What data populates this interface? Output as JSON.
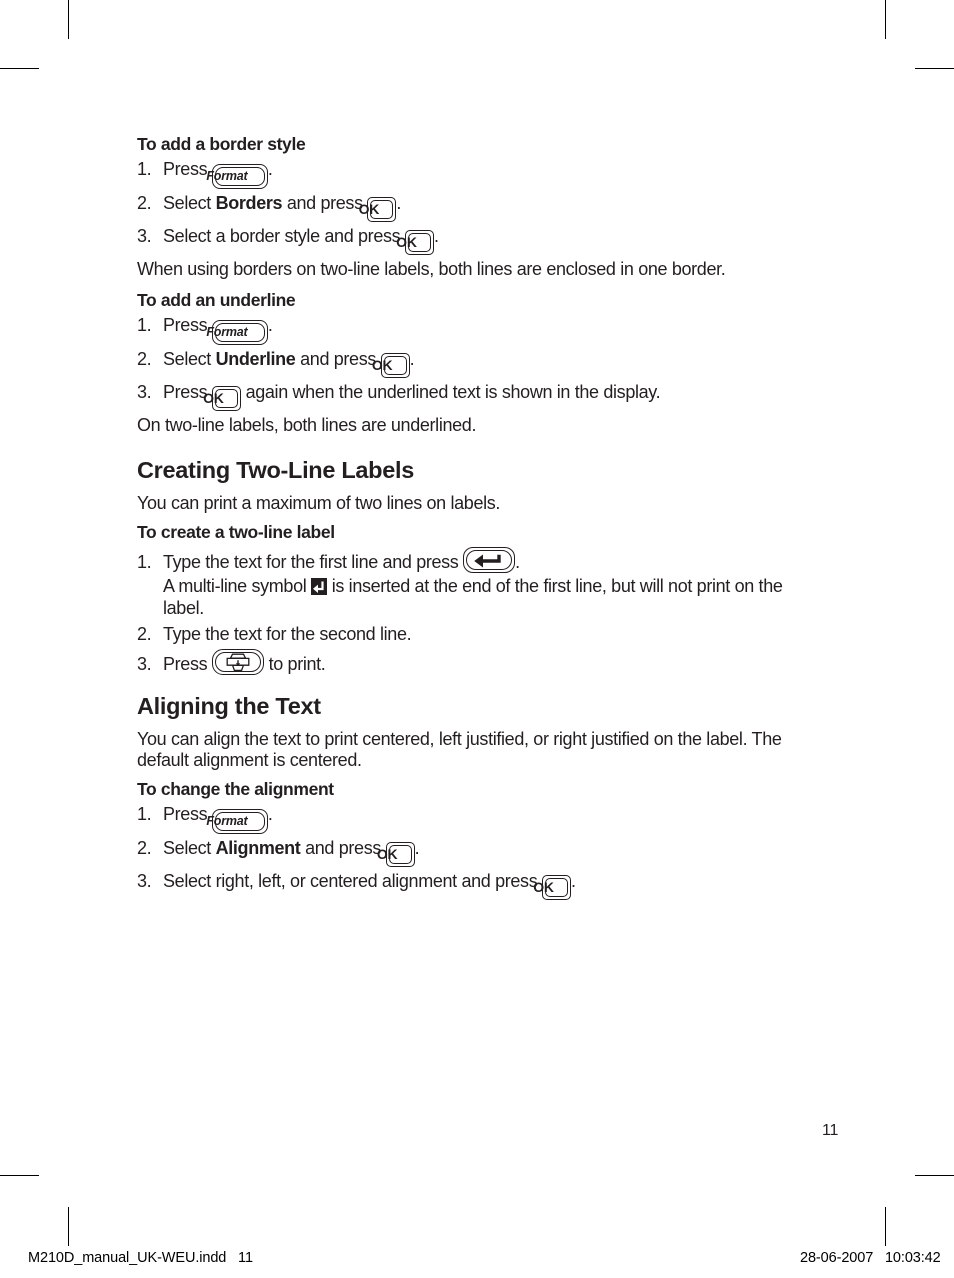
{
  "document": {
    "page_number": "11",
    "footer": {
      "file_name": "M210D_manual_UK-WEU.indd   11",
      "date_time": "28-06-2007   10:03:42"
    }
  },
  "keys": {
    "format": "Format",
    "ok": "OK",
    "return_icon": "return-key-icon",
    "print_icon": "print-key-icon",
    "multiline_glyph_icon": "multi-line-symbol-icon"
  },
  "sections": {
    "border_style": {
      "heading": "To add a border style",
      "steps": [
        {
          "num": "1.",
          "before": "Press ",
          "key": "format",
          "after": "."
        },
        {
          "num": "2.",
          "before": "Select ",
          "bold": "Borders",
          "mid": " and press ",
          "key": "ok",
          "after": "."
        },
        {
          "num": "3.",
          "before": "Select a border style and press ",
          "key": "ok",
          "after": "."
        }
      ],
      "note": "When using borders on two-line labels, both lines are enclosed in one border."
    },
    "underline": {
      "heading": "To add an underline",
      "steps": [
        {
          "num": "1.",
          "before": "Press ",
          "key": "format",
          "after": "."
        },
        {
          "num": "2.",
          "before": "Select ",
          "bold": "Underline",
          "mid": " and press ",
          "key": "ok",
          "after": "."
        },
        {
          "num": "3.",
          "before": "Press ",
          "key": "ok",
          "after": " again when the underlined text is shown in the display."
        }
      ],
      "note": "On two-line labels, both lines are underlined."
    },
    "two_line_labels": {
      "heading": "Creating Two-Line Labels",
      "intro": "You can print a maximum of two lines on labels.",
      "sub_heading": "To create a two-line label",
      "step1": {
        "num": "1.",
        "before": "Type the text for the first line and press ",
        "key": "return",
        "after": "."
      },
      "step1_note_before": "A multi-line symbol ",
      "step1_note_after": " is inserted at the end of the first line, but will not print on the label.",
      "step2": {
        "num": "2.",
        "text": "Type the text for the second line."
      },
      "step3": {
        "num": "3.",
        "before": "Press ",
        "key": "print",
        "after": " to print."
      }
    },
    "aligning_text": {
      "heading": "Aligning the Text",
      "intro": "You can align the text to print centered, left justified, or right justified on the label. The default alignment is centered.",
      "sub_heading": "To change the alignment",
      "steps": [
        {
          "num": "1.",
          "before": "Press ",
          "key": "format",
          "after": "."
        },
        {
          "num": "2.",
          "before": "Select ",
          "bold": "Alignment",
          "mid": " and press ",
          "key": "ok",
          "after": "."
        },
        {
          "num": "3.",
          "before": "Select right, left, or centered alignment and press ",
          "key": "ok",
          "after": "."
        }
      ]
    }
  }
}
